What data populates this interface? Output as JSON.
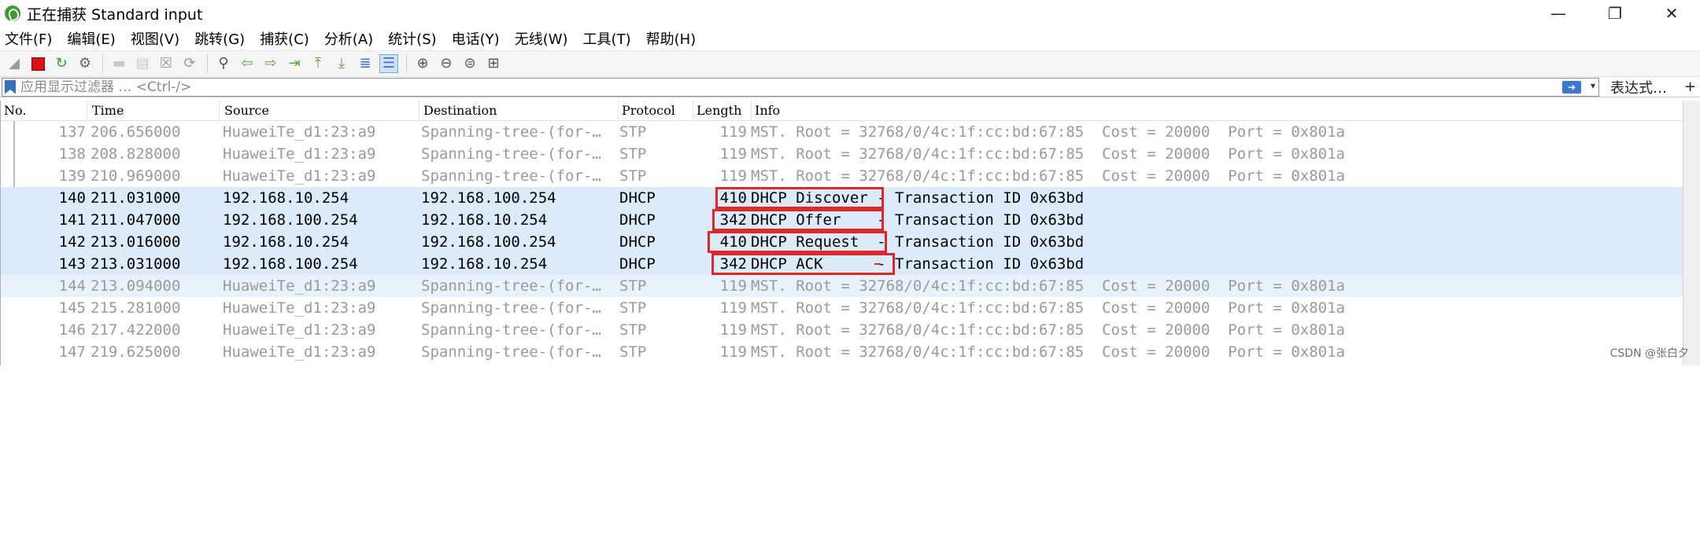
{
  "window": {
    "title": "正在捕获 Standard input",
    "controls": [
      "—",
      "❐",
      "✕"
    ]
  },
  "menu": [
    "文件(F)",
    "编辑(E)",
    "视图(V)",
    "跳转(G)",
    "捕获(C)",
    "分析(A)",
    "统计(S)",
    "电话(Y)",
    "无线(W)",
    "工具(T)",
    "帮助(H)"
  ],
  "filter": {
    "placeholder": "应用显示过滤器 … <Ctrl-/>",
    "expression_label": "表达式…",
    "plus_label": "+"
  },
  "columns": [
    "No.",
    "Time",
    "Source",
    "Destination",
    "Protocol",
    "Length",
    "Info"
  ],
  "packets": [
    {
      "no": "137",
      "time": "206.656000",
      "src": "HuaweiTe_d1:23:a9",
      "dst": "Spanning-tree-(for-…",
      "proto": "STP",
      "len": "119",
      "info": "MST. Root = 32768/0/4c:1f:cc:bd:67:85  Cost = 20000  Port = 0x801a"
    },
    {
      "no": "138",
      "time": "208.828000",
      "src": "HuaweiTe_d1:23:a9",
      "dst": "Spanning-tree-(for-…",
      "proto": "STP",
      "len": "119",
      "info": "MST. Root = 32768/0/4c:1f:cc:bd:67:85  Cost = 20000  Port = 0x801a"
    },
    {
      "no": "139",
      "time": "210.969000",
      "src": "HuaweiTe_d1:23:a9",
      "dst": "Spanning-tree-(for-…",
      "proto": "STP",
      "len": "119",
      "info": "MST. Root = 32768/0/4c:1f:cc:bd:67:85  Cost = 20000  Port = 0x801a"
    },
    {
      "no": "140",
      "time": "211.031000",
      "src": "192.168.10.254",
      "dst": "192.168.100.254",
      "proto": "DHCP",
      "len": "410",
      "info": "DHCP Discover - Transaction ID 0x63bd"
    },
    {
      "no": "141",
      "time": "211.047000",
      "src": "192.168.100.254",
      "dst": "192.168.10.254",
      "proto": "DHCP",
      "len": "342",
      "info": "DHCP Offer    - Transaction ID 0x63bd"
    },
    {
      "no": "142",
      "time": "213.016000",
      "src": "192.168.10.254",
      "dst": "192.168.100.254",
      "proto": "DHCP",
      "len": "410",
      "info": "DHCP Request  - Transaction ID 0x63bd"
    },
    {
      "no": "143",
      "time": "213.031000",
      "src": "192.168.100.254",
      "dst": "192.168.10.254",
      "proto": "DHCP",
      "len": "342",
      "info": "DHCP ACK      - Transaction ID 0x63bd"
    },
    {
      "no": "144",
      "time": "213.094000",
      "src": "HuaweiTe_d1:23:a9",
      "dst": "Spanning-tree-(for-…",
      "proto": "STP",
      "len": "119",
      "info": "MST. Root = 32768/0/4c:1f:cc:bd:67:85  Cost = 20000  Port = 0x801a"
    },
    {
      "no": "145",
      "time": "215.281000",
      "src": "HuaweiTe_d1:23:a9",
      "dst": "Spanning-tree-(for-…",
      "proto": "STP",
      "len": "119",
      "info": "MST. Root = 32768/0/4c:1f:cc:bd:67:85  Cost = 20000  Port = 0x801a"
    },
    {
      "no": "146",
      "time": "217.422000",
      "src": "HuaweiTe_d1:23:a9",
      "dst": "Spanning-tree-(for-…",
      "proto": "STP",
      "len": "119",
      "info": "MST. Root = 32768/0/4c:1f:cc:bd:67:85  Cost = 20000  Port = 0x801a"
    },
    {
      "no": "147",
      "time": "219.625000",
      "src": "HuaweiTe_d1:23:a9",
      "dst": "Spanning-tree-(for-…",
      "proto": "STP",
      "len": "119",
      "info": "MST. Root = 32768/0/4c:1f:cc:bd:67:85  Cost = 20000  Port = 0x801a"
    }
  ],
  "watermark": "CSDN @张白夕",
  "colors": {
    "dhcp_row": "#dbebfa",
    "stp_text": "#9a9a9a",
    "highlight_box": "#e02626",
    "app_icon": "#3c9a2f"
  }
}
